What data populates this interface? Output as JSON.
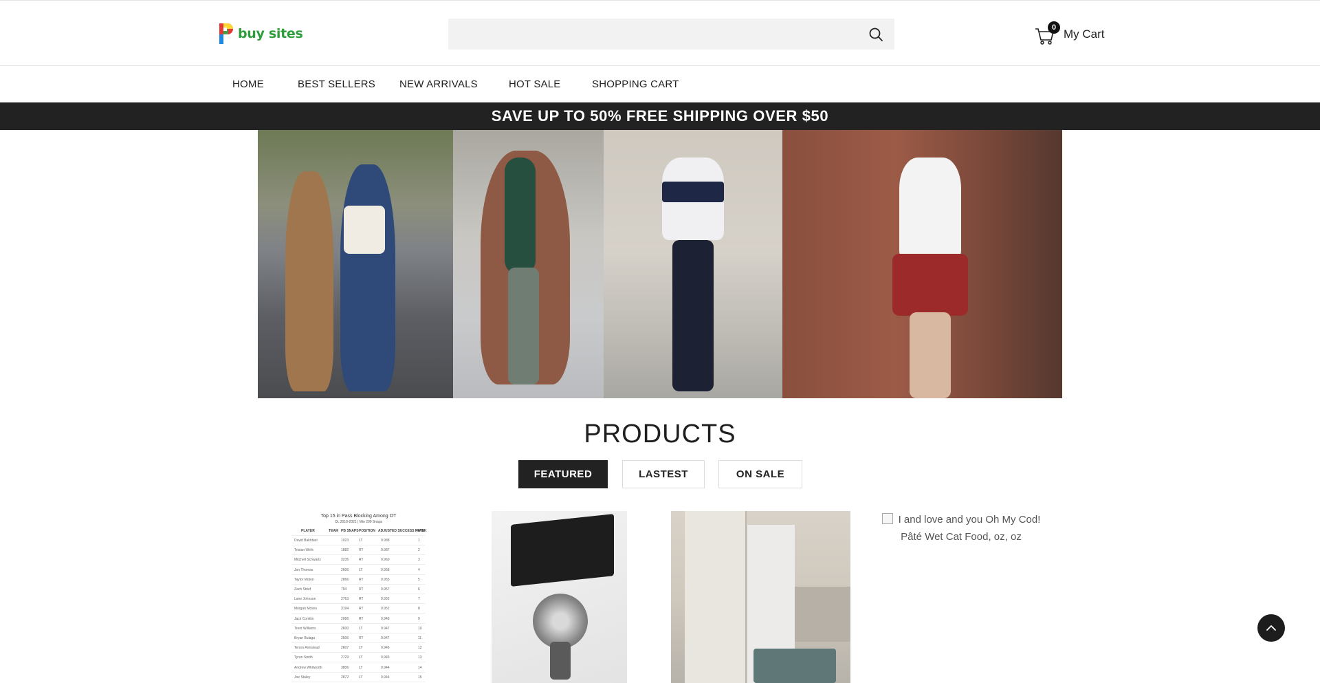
{
  "header": {
    "logo_text": "buy sites",
    "search": {
      "placeholder": "",
      "value": ""
    },
    "cart": {
      "count": "0",
      "label": "My Cart"
    }
  },
  "nav": {
    "items": [
      {
        "label": "HOME"
      },
      {
        "label": "BEST SELLERS"
      },
      {
        "label": "NEW ARRIVALS"
      },
      {
        "label": "HOT SALE"
      },
      {
        "label": "SHOPPING CART"
      }
    ]
  },
  "promo": {
    "text": "SAVE UP TO 50% FREE SHIPPING OVER $50"
  },
  "products": {
    "title": "PRODUCTS",
    "tabs": [
      {
        "label": "FEATURED",
        "active": true
      },
      {
        "label": "LASTEST",
        "active": false
      },
      {
        "label": "ON SALE",
        "active": false
      }
    ],
    "items": [
      {
        "image_table": {
          "title": "Top 15 in Pass Blocking Among OT",
          "subtitle": "OL 2019-2021 | Min 200 Snaps",
          "headers": [
            "PLAYER",
            "TEAM",
            "PB SNAPS",
            "POSITION",
            "ADJUSTED SUCCESS RATE",
            "RANK"
          ],
          "rows": [
            [
              "David Bakhtiari",
              "",
              "1023",
              "LT",
              "0.988",
              "1"
            ],
            [
              "Tristan Wirfs",
              "",
              "1882",
              "RT",
              "0.987",
              "2"
            ],
            [
              "Mitchell Schwartz",
              "",
              "3235",
              "RT",
              "0.960",
              "3"
            ],
            [
              "Jon Thomas",
              "",
              "2606",
              "LT",
              "0.958",
              "4"
            ],
            [
              "Taylor Moton",
              "",
              "2866",
              "RT",
              "0.955",
              "5"
            ],
            [
              "Zach Strief",
              "",
              "794",
              "RT",
              "0.957",
              "6"
            ],
            [
              "Lane Johnson",
              "",
              "2763",
              "RT",
              "0.952",
              "7"
            ],
            [
              "Morgan Moses",
              "",
              "3194",
              "RT",
              "0.951",
              "8"
            ],
            [
              "Jack Conklin",
              "",
              "2066",
              "RT",
              "0.949",
              "9"
            ],
            [
              "Trent Williams",
              "",
              "2600",
              "LT",
              "0.947",
              "10"
            ],
            [
              "Bryan Bulaga",
              "",
              "2506",
              "RT",
              "0.947",
              "11"
            ],
            [
              "Terron Armstead",
              "",
              "2607",
              "LT",
              "0.946",
              "12"
            ],
            [
              "Tyron Smith",
              "",
              "2729",
              "LT",
              "0.945",
              "13"
            ],
            [
              "Andrew Whitworth",
              "",
              "3806",
              "LT",
              "0.944",
              "14"
            ],
            [
              "Joe Staley",
              "",
              "2872",
              "LT",
              "0.944",
              "15"
            ]
          ]
        }
      },
      {
        "image_caption": ""
      },
      {
        "image_caption": ""
      },
      {
        "broken_image_alt": "I and love and you Oh My Cod! Pâté Wet Cat Food, oz, oz"
      }
    ]
  },
  "colors": {
    "accent_dark": "#222222",
    "logo_green": "#2e9e3a",
    "search_bg": "#f2f2f2"
  }
}
